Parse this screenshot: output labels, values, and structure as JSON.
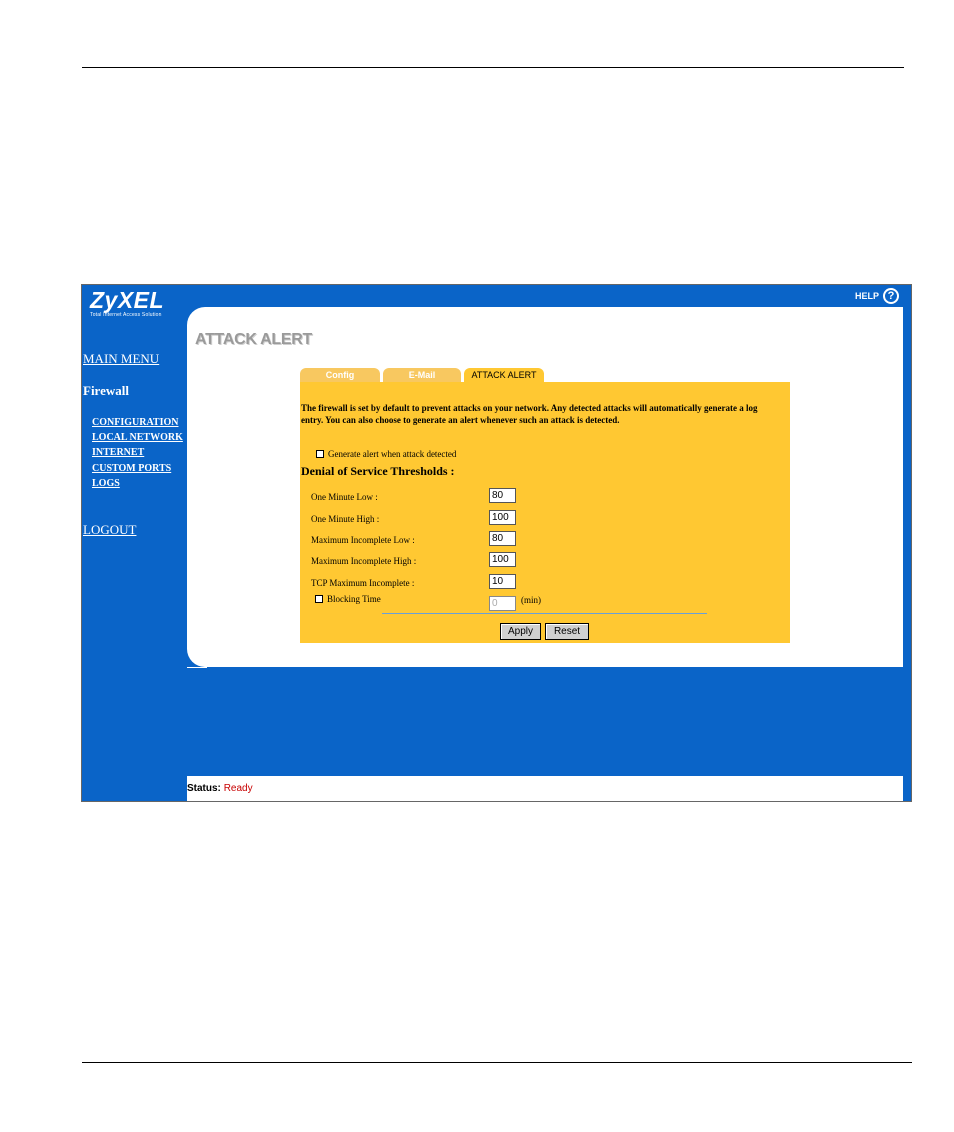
{
  "brand": {
    "name": "ZyXEL",
    "tagline": "Total Internet Access Solution"
  },
  "help": {
    "label": "HELP",
    "icon": "question-icon"
  },
  "sidebar": {
    "main_menu": "MAIN MENU",
    "section": "Firewall",
    "items": [
      {
        "label": "CONFIGURATION"
      },
      {
        "label": "LOCAL NETWORK"
      },
      {
        "label": "INTERNET"
      },
      {
        "label": "CUSTOM PORTS"
      },
      {
        "label": "LOGS"
      }
    ],
    "logout": "LOGOUT"
  },
  "page": {
    "title": "ATTACK ALERT"
  },
  "tabs": [
    {
      "label": "Config",
      "active": false
    },
    {
      "label": "E-Mail",
      "active": false
    },
    {
      "label": "ATTACK ALERT",
      "active": true
    }
  ],
  "form": {
    "description": "The firewall is set by default to prevent attacks on your network. Any detected attacks will automatically generate a log entry. You can also choose to generate an alert whenever such an attack is detected.",
    "generate_alert": {
      "label": "Generate alert when attack detected",
      "checked": false
    },
    "dos_title": "Denial of Service Thresholds :",
    "fields": [
      {
        "label": "One Minute Low :",
        "value": "80"
      },
      {
        "label": "One Minute High :",
        "value": "100"
      },
      {
        "label": "Maximum Incomplete Low :",
        "value": "80"
      },
      {
        "label": "Maximum Incomplete High :",
        "value": "100"
      },
      {
        "label": "TCP Maximum Incomplete :",
        "value": "10"
      }
    ],
    "blocking_time": {
      "label": "Blocking Time",
      "value": "0",
      "unit": "(min)",
      "checked": false
    },
    "apply_label": "Apply",
    "reset_label": "Reset"
  },
  "status": {
    "label": "Status:",
    "value": "Ready"
  },
  "colors": {
    "frame_blue": "#0a64c8",
    "panel_yellow": "#ffc832",
    "tab_inactive": "#f8c860",
    "status_value": "#c80000"
  }
}
